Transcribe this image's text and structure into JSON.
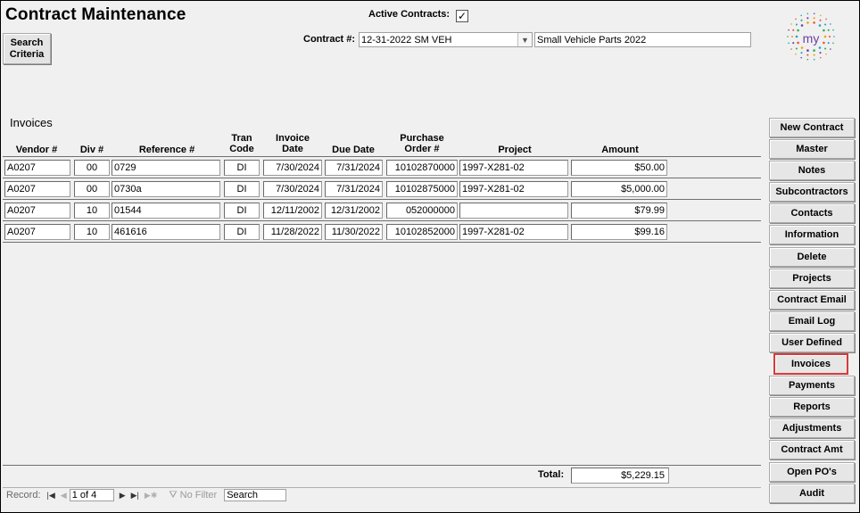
{
  "header": {
    "title": "Contract Maintenance",
    "search_criteria_label": "Search\nCriteria",
    "active_contracts_label": "Active Contracts:",
    "active_contracts_checked": true,
    "contract_label": "Contract #:",
    "contract_value": "12-31-2022 SM VEH",
    "contract_description": "Small Vehicle Parts 2022",
    "logo_text": "my"
  },
  "invoices": {
    "section_title": "Invoices",
    "columns": {
      "vendor": "Vendor #",
      "div": "Div #",
      "reference": "Reference #",
      "tran_code": "Tran\nCode",
      "invoice_date": "Invoice\nDate",
      "due_date": "Due Date",
      "purchase_order": "Purchase\nOrder #",
      "project": "Project",
      "amount": "Amount"
    },
    "rows": [
      {
        "vendor": "A0207",
        "div": "00",
        "reference": "0729",
        "tran_code": "DI",
        "invoice_date": "7/30/2024",
        "due_date": "7/31/2024",
        "purchase_order": "10102870000",
        "project": "1997-X281-02",
        "amount": "$50.00"
      },
      {
        "vendor": "A0207",
        "div": "00",
        "reference": "0730a",
        "tran_code": "DI",
        "invoice_date": "7/30/2024",
        "due_date": "7/31/2024",
        "purchase_order": "10102875000",
        "project": "1997-X281-02",
        "amount": "$5,000.00"
      },
      {
        "vendor": "A0207",
        "div": "10",
        "reference": "01544",
        "tran_code": "DI",
        "invoice_date": "12/11/2002",
        "due_date": "12/31/2002",
        "purchase_order": "052000000",
        "project": "",
        "amount": "$79.99"
      },
      {
        "vendor": "A0207",
        "div": "10",
        "reference": "461616",
        "tran_code": "DI",
        "invoice_date": "11/28/2022",
        "due_date": "11/30/2022",
        "purchase_order": "10102852000",
        "project": "1997-X281-02",
        "amount": "$99.16"
      }
    ],
    "total_label": "Total:",
    "total_value": "$5,229.15"
  },
  "navigation": {
    "record_label": "Record:",
    "position": "1 of 4",
    "no_filter_label": "No Filter",
    "search_value": "Search"
  },
  "sidebar": {
    "items": [
      {
        "label": "New Contract"
      },
      {
        "label": "Master"
      },
      {
        "label": "Notes"
      },
      {
        "label": "Subcontractors"
      },
      {
        "label": "Contacts"
      },
      {
        "label": "Information"
      },
      {
        "label": "Delete"
      },
      {
        "label": "Projects"
      },
      {
        "label": "Contract Email"
      },
      {
        "label": "Email Log"
      },
      {
        "label": "User Defined"
      },
      {
        "label": "Invoices"
      },
      {
        "label": "Payments"
      },
      {
        "label": "Reports"
      },
      {
        "label": "Adjustments"
      },
      {
        "label": "Contract Amt"
      },
      {
        "label": "Open PO's"
      },
      {
        "label": "Audit"
      }
    ],
    "selected_item": "Invoices",
    "selected_outline_color": "#d93a3a"
  }
}
